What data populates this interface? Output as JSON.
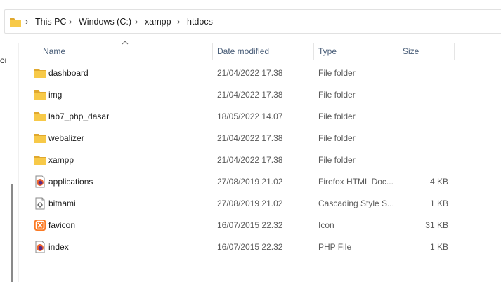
{
  "address_bar": {
    "crumbs": [
      "This PC",
      "Windows (C:)",
      "xampp",
      "htdocs"
    ],
    "separator": "›"
  },
  "left_pane": {
    "cut_text": "or"
  },
  "columns": {
    "name": "Name",
    "date_modified": "Date modified",
    "type": "Type",
    "size": "Size",
    "sort_indicator": "^"
  },
  "files": [
    {
      "name": "dashboard",
      "date": "21/04/2022 17.38",
      "type": "File folder",
      "size": "",
      "icon": "folder-icon"
    },
    {
      "name": "img",
      "date": "21/04/2022 17.38",
      "type": "File folder",
      "size": "",
      "icon": "folder-icon"
    },
    {
      "name": "lab7_php_dasar",
      "date": "18/05/2022 14.07",
      "type": "File folder",
      "size": "",
      "icon": "folder-icon"
    },
    {
      "name": "webalizer",
      "date": "21/04/2022 17.38",
      "type": "File folder",
      "size": "",
      "icon": "folder-icon"
    },
    {
      "name": "xampp",
      "date": "21/04/2022 17.38",
      "type": "File folder",
      "size": "",
      "icon": "folder-icon"
    },
    {
      "name": "applications",
      "date": "27/08/2019 21.02",
      "type": "Firefox HTML Doc...",
      "size": "4 KB",
      "icon": "firefox-html-icon"
    },
    {
      "name": "bitnami",
      "date": "27/08/2019 21.02",
      "type": "Cascading Style S...",
      "size": "1 KB",
      "icon": "css-file-icon"
    },
    {
      "name": "favicon",
      "date": "16/07/2015 22.32",
      "type": "Icon",
      "size": "31 KB",
      "icon": "xampp-favicon-icon"
    },
    {
      "name": "index",
      "date": "16/07/2015 22.32",
      "type": "PHP File",
      "size": "1 KB",
      "icon": "php-file-icon"
    }
  ],
  "colors": {
    "folder": "#f7c948",
    "folder_dark": "#e0a82e",
    "header_text": "#4c607a",
    "secondary_text": "#5a5a5a",
    "xampp_orange": "#fb7a24"
  }
}
